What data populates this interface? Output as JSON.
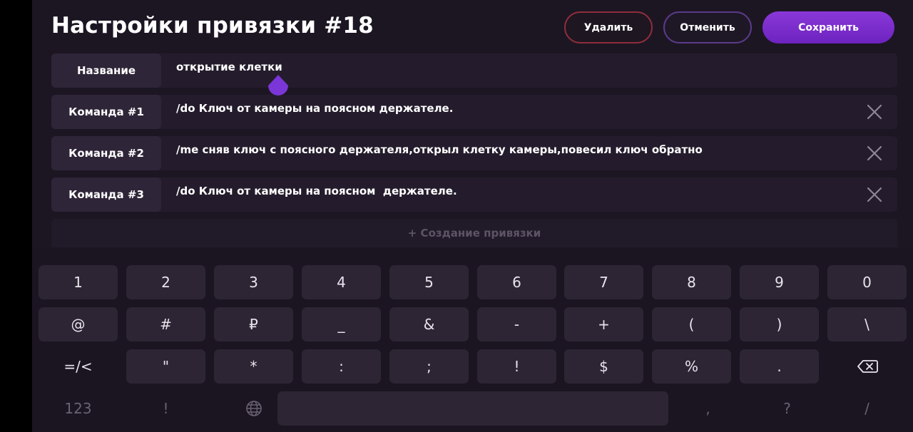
{
  "header": {
    "title": "Настройки привязки #18",
    "delete_label": "Удалить",
    "cancel_label": "Отменить",
    "save_label": "Сохранить"
  },
  "fields": [
    {
      "label": "Название",
      "value": "открытие клетки",
      "removable": false
    },
    {
      "label": "Команда #1",
      "value": "/do Ключ от камеры на поясном держателе.",
      "removable": true
    },
    {
      "label": "Команда #2",
      "value": "/me сняв ключ с поясного держателя,открыл клетку камеры,повесил ключ обратно",
      "removable": true
    },
    {
      "label": "Команда #3",
      "value": "/do Ключ от камеры на поясном  держателе.",
      "removable": true
    }
  ],
  "create_label": "+ Создание привязки",
  "keyboard": {
    "row1": [
      "1",
      "2",
      "3",
      "4",
      "5",
      "6",
      "7",
      "8",
      "9",
      "0"
    ],
    "row2": [
      "@",
      "#",
      "₽",
      "_",
      "&",
      "-",
      "+",
      "(",
      ")",
      "\\"
    ],
    "row3": [
      "=/<",
      "\"",
      "*",
      ":",
      ";",
      "!",
      "$",
      "%",
      "."
    ],
    "row4": [
      "123",
      "!",
      ",",
      "?",
      "/"
    ],
    "icons": [
      "backspace-icon",
      "globe-icon"
    ]
  },
  "colors": {
    "background": "#1c1623",
    "accent": "#7a2ecb",
    "delete_border": "#8e2d3c"
  }
}
